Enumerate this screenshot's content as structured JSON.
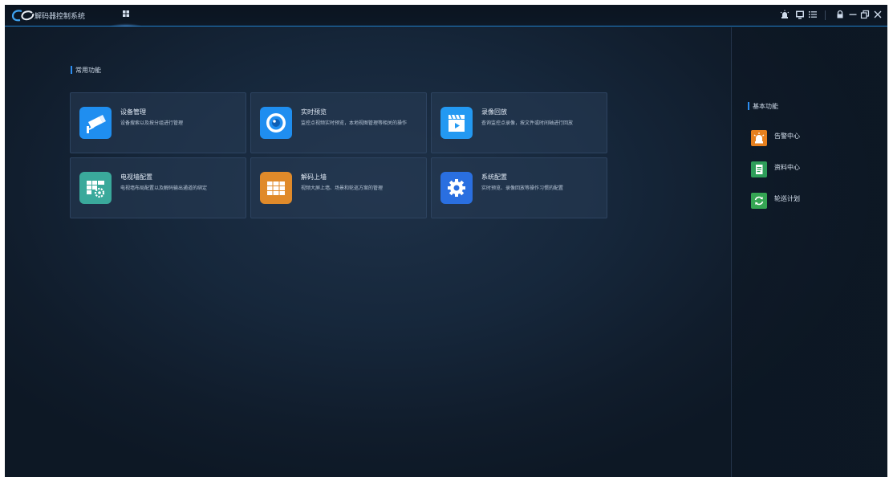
{
  "app": {
    "title": "解码器控制系统"
  },
  "titlebar": {
    "menu_icon": "grid-icon",
    "icons": [
      "alarm-icon",
      "screen-icon",
      "list-icon",
      "lock-icon",
      "minimize-icon",
      "restore-icon",
      "close-icon"
    ]
  },
  "main": {
    "section_title": "常用功能",
    "cards": [
      {
        "title": "设备管理",
        "desc": "设备搜索以及按分组进行管理",
        "icon": "camera-icon",
        "color": "#1f8ef0"
      },
      {
        "title": "实时预览",
        "desc": "监控点视频实时预览，本地视图管理等相关的操作",
        "icon": "eye-icon",
        "color": "#1f8ef0"
      },
      {
        "title": "录像回放",
        "desc": "查询监控点录像，按文件或时间轴进行回放",
        "icon": "clapper-icon",
        "color": "#1f8ef0"
      },
      {
        "title": "电视墙配置",
        "desc": "电视墙布局配置以及解码输出通道的绑定",
        "icon": "tv-wall-config-icon",
        "color": "#3aa99b"
      },
      {
        "title": "解码上墙",
        "desc": "视频大屏上墙、场景和轮巡方案的管理",
        "icon": "wall-decode-icon",
        "color": "#e08a2a"
      },
      {
        "title": "系统配置",
        "desc": "实时预览、录像回放等操作习惯的配置",
        "icon": "gear-icon",
        "color": "#2a6fe0"
      }
    ]
  },
  "sidebar": {
    "section_title": "基本功能",
    "items": [
      {
        "label": "告警中心",
        "icon": "alarm-light-icon",
        "color": "#e6801e"
      },
      {
        "label": "资料中心",
        "icon": "document-icon",
        "color": "#2e9e5a"
      },
      {
        "label": "轮巡计划",
        "icon": "refresh-icon",
        "color": "#35a653"
      }
    ]
  }
}
